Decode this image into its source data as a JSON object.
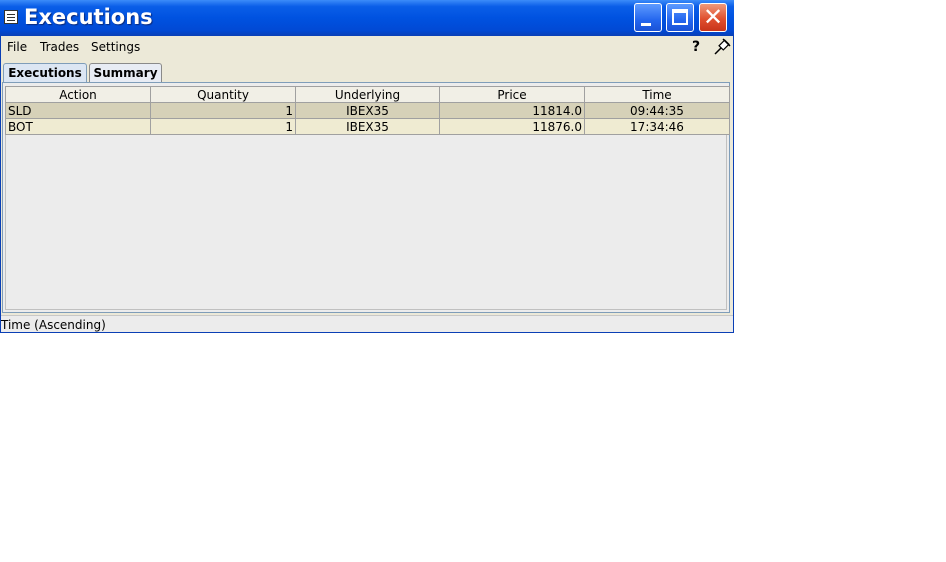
{
  "window": {
    "title": "Executions",
    "minimize_icon": "minimize-icon",
    "maximize_icon": "maximize-icon",
    "close_icon": "close-icon",
    "close_glyph": "✕"
  },
  "menu": {
    "file": "File",
    "trades": "Trades",
    "settings": "Settings",
    "help_icon": "help-icon",
    "help_glyph": "?",
    "pin_icon": "pin-icon"
  },
  "tabs": [
    {
      "label": "Executions",
      "active": true
    },
    {
      "label": "Summary",
      "active": false
    }
  ],
  "table": {
    "columns": [
      "Action",
      "Quantity",
      "Underlying",
      "Price",
      "Time"
    ],
    "rows": [
      [
        "SLD",
        "1",
        "IBEX35",
        "11814.0",
        "09:44:35"
      ],
      [
        "BOT",
        "1",
        "IBEX35",
        "11876.0",
        "17:34:46"
      ]
    ]
  },
  "status": {
    "text": "Time (Ascending)"
  },
  "colors": {
    "titlebar": "#0052e0",
    "row_odd": "#d6d1b8",
    "row_even": "#efebd2",
    "close_button": "#e0502f"
  }
}
